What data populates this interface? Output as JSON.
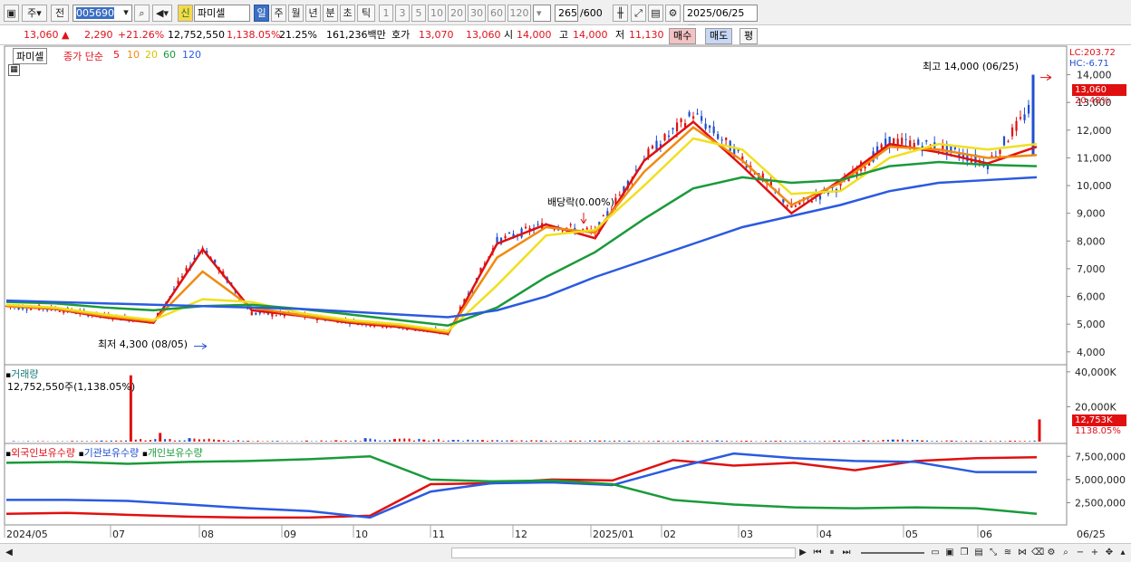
{
  "toolbar": {
    "market": "주",
    "prev": "전",
    "code": "005690",
    "badge": "신",
    "name": "파미셀",
    "periods": [
      "일",
      "주",
      "월",
      "년",
      "분",
      "초",
      "틱"
    ],
    "active_period": "일",
    "ticks": [
      "1",
      "3",
      "5",
      "10",
      "20",
      "30",
      "60",
      "120"
    ],
    "bar_count": "265",
    "bar_max": "/600",
    "date": "2025/06/25"
  },
  "quote": {
    "price": "13,060",
    "change": "2,290",
    "change_pct": "+21.26%",
    "volume": "12,752,550",
    "volume_pct": "1,138.05%",
    "turnover": "21.25%",
    "amount": "161,236백만",
    "ask_label": "호가",
    "ask": "13,070",
    "bid": "13,060",
    "open_label": "시",
    "open": "14,000",
    "high_label": "고",
    "high": "14,000",
    "low_label": "저",
    "low": "11,130",
    "buy": "매수",
    "sell": "매도",
    "eval": "평"
  },
  "price_legend": {
    "stock": "파미셀",
    "close": "종가 단순",
    "ma": [
      "5",
      "10",
      "20",
      "60",
      "120"
    ],
    "ma_colors": [
      "#e01010",
      "#f08a10",
      "#f0e020",
      "#1a9a3a",
      "#2a5ae0"
    ]
  },
  "price_annot": {
    "lc": "LC:203.72",
    "hc": "HC:-6.71",
    "high": "최고 14,000 (06/25)",
    "low": "최저 4,300 (08/05)",
    "dividend": "배당락(0.00%)",
    "price_tag": "13,060",
    "pct_tag": "20.48%"
  },
  "volume_legend": {
    "title": "거래량",
    "value": "12,752,550주(1,138.05%)",
    "tag": "12,753K",
    "pct": "1138.05%"
  },
  "holding_legend": {
    "items": [
      "외국인보유수량",
      "기관보유수량",
      "개인보유수량"
    ],
    "colors": [
      "#e01010",
      "#2a5ae0",
      "#1a9a3a"
    ]
  },
  "x_labels": [
    "2024/05",
    "07",
    "08",
    "09",
    "10",
    "11",
    "12",
    "2025/01",
    "02",
    "03",
    "04",
    "05",
    "06",
    "06/25"
  ],
  "chart_data": [
    {
      "type": "candlestick",
      "title": "",
      "y_axis": [
        "14,000",
        "13,000",
        "12,000",
        "11,000",
        "10,000",
        "9,000",
        "8,000",
        "7,000",
        "6,000",
        "5,000",
        "4,000"
      ],
      "ylim": [
        3700,
        14900
      ],
      "x": [
        "2024/05",
        "07",
        "08",
        "09",
        "10",
        "11",
        "12",
        "2025/01",
        "02",
        "03",
        "04",
        "05",
        "06",
        "06/25"
      ],
      "close": [
        5650,
        5550,
        5300,
        5100,
        7800,
        5400,
        5300,
        5100,
        4900,
        4700,
        8000,
        8600,
        8300,
        11000,
        12600,
        11000,
        9200,
        10000,
        11600,
        11400,
        10800,
        13060
      ],
      "series": [
        {
          "name": "5",
          "values": [
            5650,
            5550,
            5250,
            5050,
            7700,
            5500,
            5300,
            5050,
            4900,
            4650,
            7900,
            8600,
            8100,
            10900,
            12300,
            10700,
            9000,
            10200,
            11500,
            11200,
            10800,
            11400
          ]
        },
        {
          "name": "10",
          "values": [
            5650,
            5560,
            5300,
            5100,
            6900,
            5600,
            5330,
            5100,
            4950,
            4700,
            7400,
            8500,
            8300,
            10500,
            12100,
            10900,
            9300,
            10100,
            11400,
            11300,
            11000,
            11100
          ]
        },
        {
          "name": "20",
          "values": [
            5700,
            5600,
            5350,
            5150,
            5900,
            5800,
            5400,
            5150,
            5000,
            4750,
            6400,
            8200,
            8400,
            10000,
            11700,
            11300,
            9700,
            9800,
            11000,
            11500,
            11300,
            11500
          ]
        },
        {
          "name": "60",
          "values": [
            5800,
            5750,
            5600,
            5500,
            5650,
            5700,
            5550,
            5350,
            5150,
            4950,
            5600,
            6700,
            7600,
            8800,
            9900,
            10300,
            10100,
            10200,
            10700,
            10850,
            10750,
            10700
          ]
        },
        {
          "name": "120",
          "values": [
            5850,
            5800,
            5750,
            5700,
            5650,
            5600,
            5550,
            5450,
            5350,
            5250,
            5500,
            6000,
            6700,
            7300,
            7900,
            8500,
            8900,
            9300,
            9800,
            10100,
            10200,
            10300
          ]
        }
      ],
      "high_marker": {
        "value": 14000,
        "date": "06/25"
      },
      "low_marker": {
        "value": 4300,
        "date": "08/05"
      }
    },
    {
      "type": "bar",
      "title": "거래량",
      "y_axis": [
        "40,000K",
        "20,000K"
      ],
      "ylim": [
        0,
        42000
      ],
      "values_k": [
        300,
        250,
        400,
        600,
        38000,
        5000,
        2000,
        900,
        500,
        400,
        600,
        800,
        2000,
        1500,
        1200,
        1000,
        900,
        800,
        700,
        600,
        600,
        500,
        500,
        600,
        700,
        500,
        500,
        400,
        600,
        900,
        1200,
        700,
        600,
        500,
        500,
        12753
      ]
    },
    {
      "type": "line",
      "title": "외국인보유수량",
      "y_axis": [
        "7,500,000",
        "5,000,000",
        "2,500,000"
      ],
      "ylim": [
        500000,
        8500000
      ],
      "series": [
        {
          "name": "외국인보유수량",
          "values": [
            1300000,
            1400000,
            1200000,
            1000000,
            900000,
            900000,
            1100000,
            4500000,
            4600000,
            5000000,
            4900000,
            7100000,
            6500000,
            6800000,
            6000000,
            7000000,
            7300000,
            7400000
          ]
        },
        {
          "name": "기관보유수량",
          "values": [
            2800000,
            2800000,
            2700000,
            2300000,
            1900000,
            1600000,
            900000,
            3700000,
            4600000,
            4700000,
            4400000,
            6200000,
            7800000,
            7300000,
            7000000,
            6900000,
            5800000,
            5800000
          ]
        },
        {
          "name": "개인보유수량",
          "values": [
            6800000,
            6900000,
            6700000,
            6900000,
            7000000,
            7200000,
            7500000,
            5000000,
            4800000,
            4900000,
            4500000,
            2800000,
            2300000,
            2000000,
            1900000,
            2000000,
            1900000,
            1300000
          ]
        }
      ]
    }
  ]
}
